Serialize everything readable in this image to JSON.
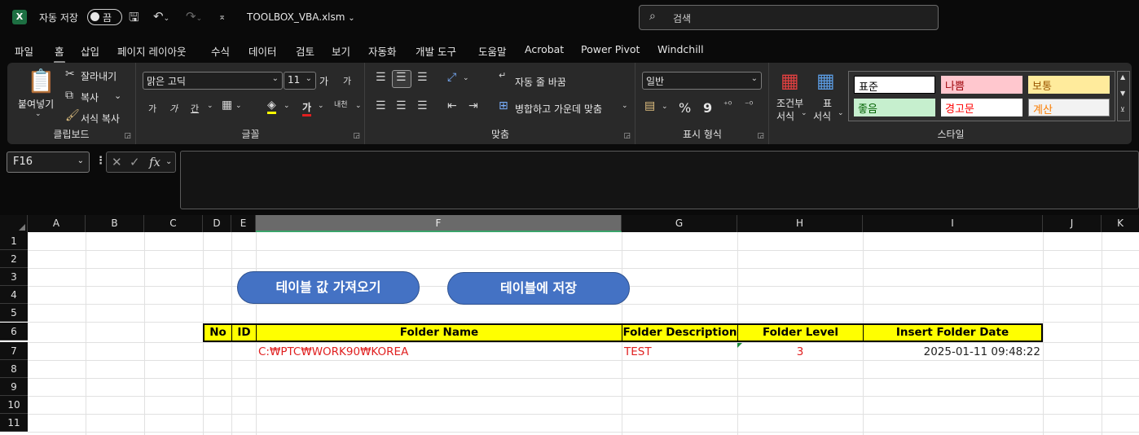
{
  "titlebar": {
    "app_icon": "excel-icon",
    "logo_letter": "X",
    "autosave_label": "자동 저장",
    "autosave_state": "끔",
    "filename": "TOOLBOX_VBA.xlsm",
    "search_placeholder": "검색"
  },
  "menu": {
    "tabs": [
      "파일",
      "홈",
      "삽입",
      "페이지 레이아웃",
      "수식",
      "데이터",
      "검토",
      "보기",
      "자동화",
      "개발 도구",
      "도움말",
      "Acrobat",
      "Power Pivot",
      "Windchill"
    ],
    "active": "홈"
  },
  "ribbon": {
    "clipboard": {
      "paste": "붙여넣기",
      "cut": "잘라내기",
      "copy": "복사",
      "format_painter": "서식 복사",
      "label": "클립보드"
    },
    "font": {
      "name": "맑은 고딕",
      "size": "11",
      "grow": "가",
      "shrink": "가",
      "bold": "가",
      "italic": "가",
      "underline": "간",
      "font_color": "가",
      "phonetic": "내천",
      "label": "글꼴"
    },
    "alignment": {
      "wrap_text": "자동 줄 바꿈",
      "merge_center": "병합하고 가운데 맞춤",
      "label": "맞춤"
    },
    "number": {
      "format": "일반",
      "percent": "%",
      "comma": "9",
      "label": "표시 형식"
    },
    "styles": {
      "conditional_line1": "조건부",
      "conditional_line2": "서식",
      "table_line1": "표",
      "table_line2": "서식",
      "cells": [
        {
          "label": "표준",
          "bg": "#ffffff",
          "fg": "#000000"
        },
        {
          "label": "나쁨",
          "bg": "#ffc7ce",
          "fg": "#9c0006"
        },
        {
          "label": "보통",
          "bg": "#ffeb9c",
          "fg": "#9c5700"
        },
        {
          "label": "좋음",
          "bg": "#c6efce",
          "fg": "#006100"
        },
        {
          "label": "경고문",
          "bg": "#ffffff",
          "fg": "#ff0000"
        },
        {
          "label": "계산",
          "bg": "#f2f2f2",
          "fg": "#fa7d00"
        }
      ],
      "label": "스타일"
    }
  },
  "formula_bar": {
    "name_box": "F16",
    "fx": "fx",
    "content": ""
  },
  "sheet": {
    "columns": [
      "A",
      "B",
      "C",
      "D",
      "E",
      "F",
      "G",
      "H",
      "I",
      "J",
      "K"
    ],
    "selected_column": "F",
    "rows": [
      "1",
      "2",
      "3",
      "4",
      "5",
      "6",
      "7",
      "8",
      "9",
      "10",
      "11"
    ],
    "buttons": {
      "import": "테이블 값 가져오기",
      "save": "테이블에 저장"
    },
    "table_headers": [
      "No",
      "ID",
      "Folder Name",
      "Folder Description",
      "Folder Level",
      "Insert Folder Date"
    ],
    "table_rows": [
      {
        "no": "",
        "id": "",
        "folder_name": "C:₩PTC₩WORK90₩KOREA",
        "folder_description": "TEST",
        "folder_level": "3",
        "insert_date": "2025-01-11 09:48:22"
      }
    ],
    "header_bg": "#ffff00",
    "data_color": "#e02020"
  }
}
